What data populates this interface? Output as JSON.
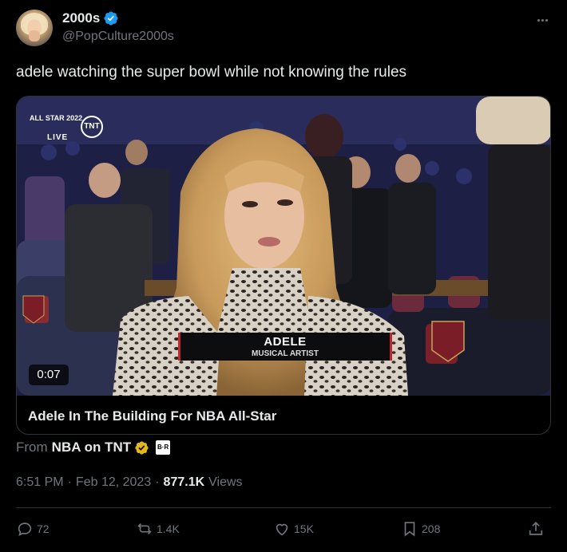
{
  "author": {
    "display_name": "2000s",
    "handle": "@PopCulture2000s"
  },
  "tweet": {
    "text": "adele watching the super bowl while not knowing the rules"
  },
  "video_card": {
    "overlay_brand": "ALL STAR 2022",
    "overlay_live": "LIVE",
    "overlay_network": "TNT",
    "lower_third_name": "ADELE",
    "lower_third_role": "MUSICAL ARTIST",
    "duration": "0:07",
    "title": "Adele In The Building For NBA All-Star"
  },
  "source": {
    "from_label": "From",
    "account": "NBA on TNT",
    "extra_badge": "B·R"
  },
  "meta": {
    "time": "6:51 PM",
    "date": "Feb 12, 2023",
    "views_count": "877.1K",
    "views_label": "Views",
    "sep": "·"
  },
  "actions": {
    "replies": "72",
    "reposts": "1.4K",
    "likes": "15K",
    "bookmarks": "208"
  },
  "colors": {
    "background": "#000000",
    "verified_blue": "#1d9bf0",
    "verified_gold": "#e2b719",
    "muted": "#71767b",
    "text": "#e7e9ea"
  }
}
